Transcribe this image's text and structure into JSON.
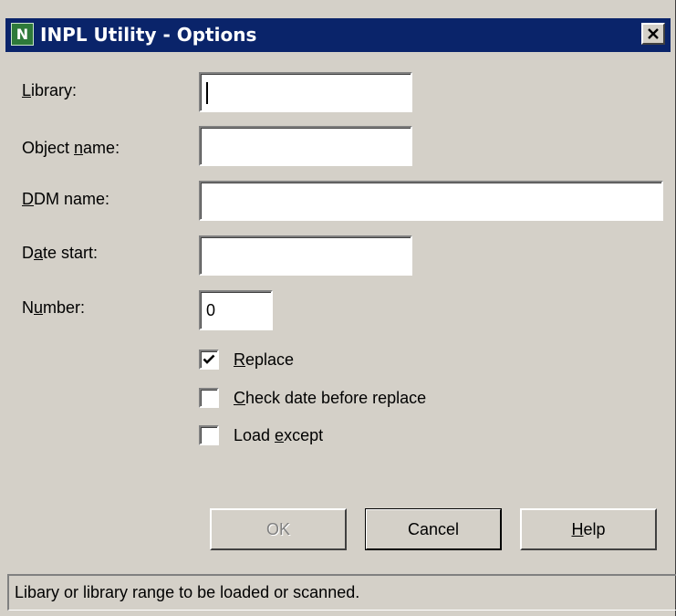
{
  "window": {
    "title": "INPL Utility - Options",
    "icon_letter": "N",
    "title_bar_color": "#0a246a"
  },
  "form": {
    "library": {
      "label_pre": "",
      "label_accel": "L",
      "label_post": "ibrary:",
      "value": ""
    },
    "object_name": {
      "label_pre": "Object ",
      "label_accel": "n",
      "label_post": "ame:",
      "value": ""
    },
    "ddm_name": {
      "label_pre": "",
      "label_accel": "D",
      "label_post": "DM name:",
      "value": ""
    },
    "date_start": {
      "label_pre": "D",
      "label_accel": "a",
      "label_post": "te start:",
      "value": ""
    },
    "number": {
      "label_pre": "N",
      "label_accel": "u",
      "label_post": "mber:",
      "value": "0"
    }
  },
  "options": {
    "replace": {
      "label_pre": "",
      "label_accel": "R",
      "label_post": "eplace",
      "checked": true
    },
    "check_date": {
      "label_pre": "",
      "label_accel": "C",
      "label_post": "heck date before replace",
      "checked": false
    },
    "load_except": {
      "label_pre": "Load ",
      "label_accel": "e",
      "label_post": "xcept",
      "checked": false
    }
  },
  "buttons": {
    "ok": "OK",
    "cancel": "Cancel",
    "help_pre": "",
    "help_accel": "H",
    "help_post": "elp"
  },
  "status": {
    "text": "Libary or library range to be loaded or scanned."
  }
}
